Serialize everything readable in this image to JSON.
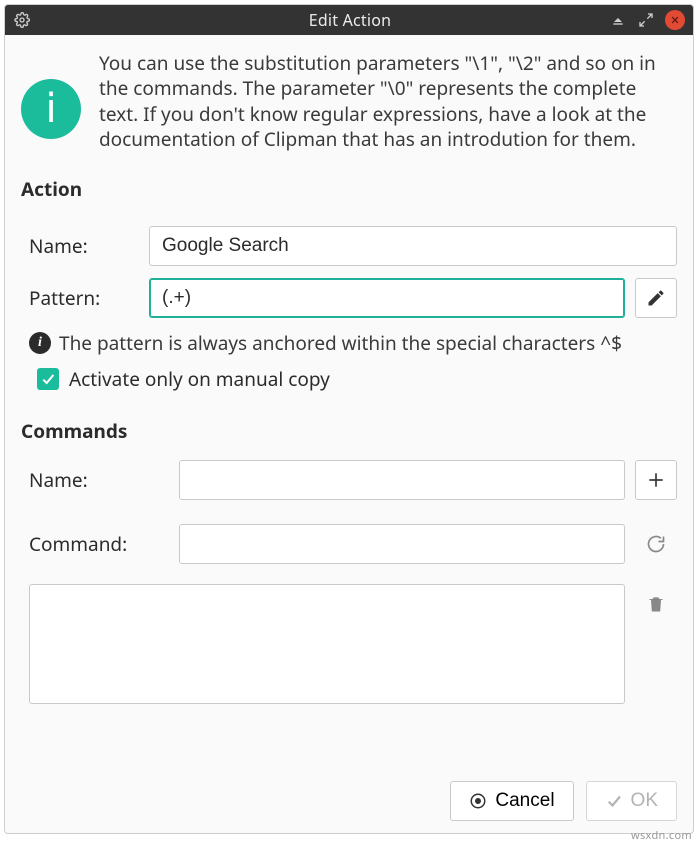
{
  "window": {
    "title": "Edit Action"
  },
  "info": {
    "text": "You can use the substitution parameters \"\\1\", \"\\2\" and so on in the commands. The parameter \"\\0\" represents the complete text. If you don't know regular expressions, have a look at the documentation of Clipman that has an introdution for them."
  },
  "action": {
    "heading": "Action",
    "name_label": "Name:",
    "name_value": "Google Search",
    "pattern_label": "Pattern:",
    "pattern_value": "(.+)",
    "pattern_hint": "The pattern is always anchored within the special characters ^$",
    "activate_label": "Activate only on manual copy",
    "activate_checked": true
  },
  "commands": {
    "heading": "Commands",
    "name_label": "Name:",
    "name_value": "",
    "command_label": "Command:",
    "command_value": ""
  },
  "footer": {
    "cancel": "Cancel",
    "ok": "OK"
  },
  "watermark": "wsxdn.com"
}
